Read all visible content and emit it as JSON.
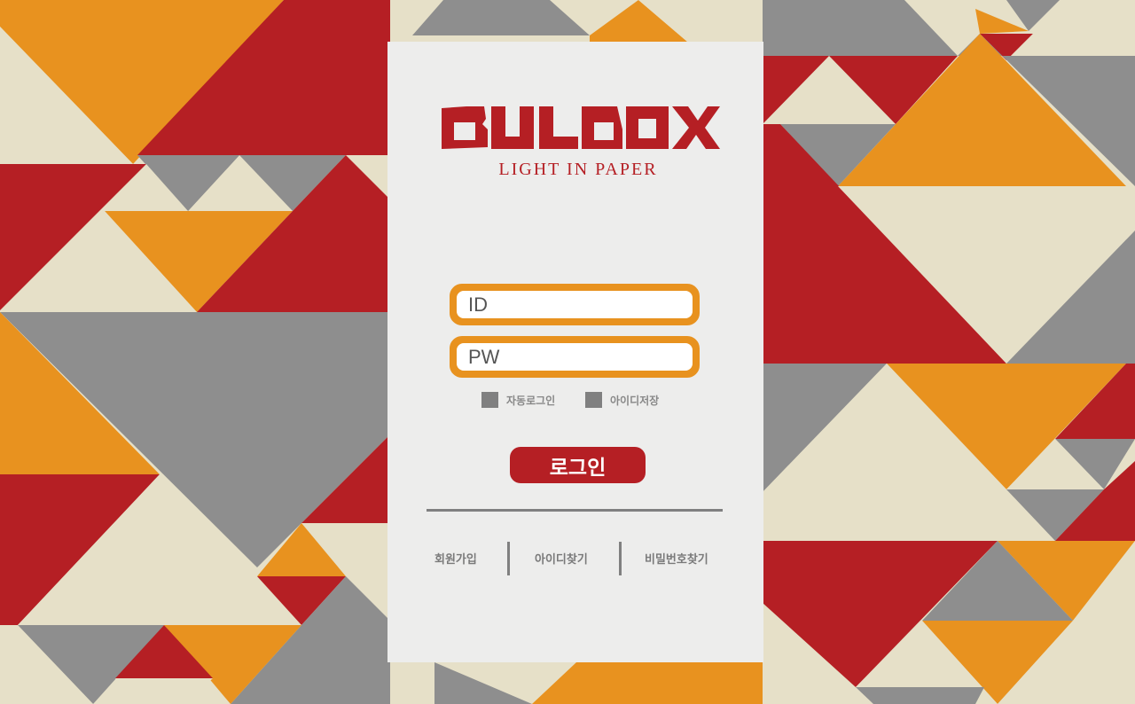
{
  "brand": {
    "name": "BULBOX",
    "tagline": "LIGHT IN PAPER"
  },
  "colors": {
    "red": "#b51f24",
    "orange": "#e8921f",
    "gray": "#8e8e8e",
    "cream": "#e6e0c8",
    "panel": "#ededec"
  },
  "form": {
    "id_placeholder": "ID",
    "pw_placeholder": "PW",
    "auto_login_label": "자동로그인",
    "save_id_label": "아이디저장",
    "login_button": "로그인"
  },
  "links": {
    "join": "회원가입",
    "find_id": "아이디찾기",
    "find_pw": "비밀번호찾기"
  }
}
